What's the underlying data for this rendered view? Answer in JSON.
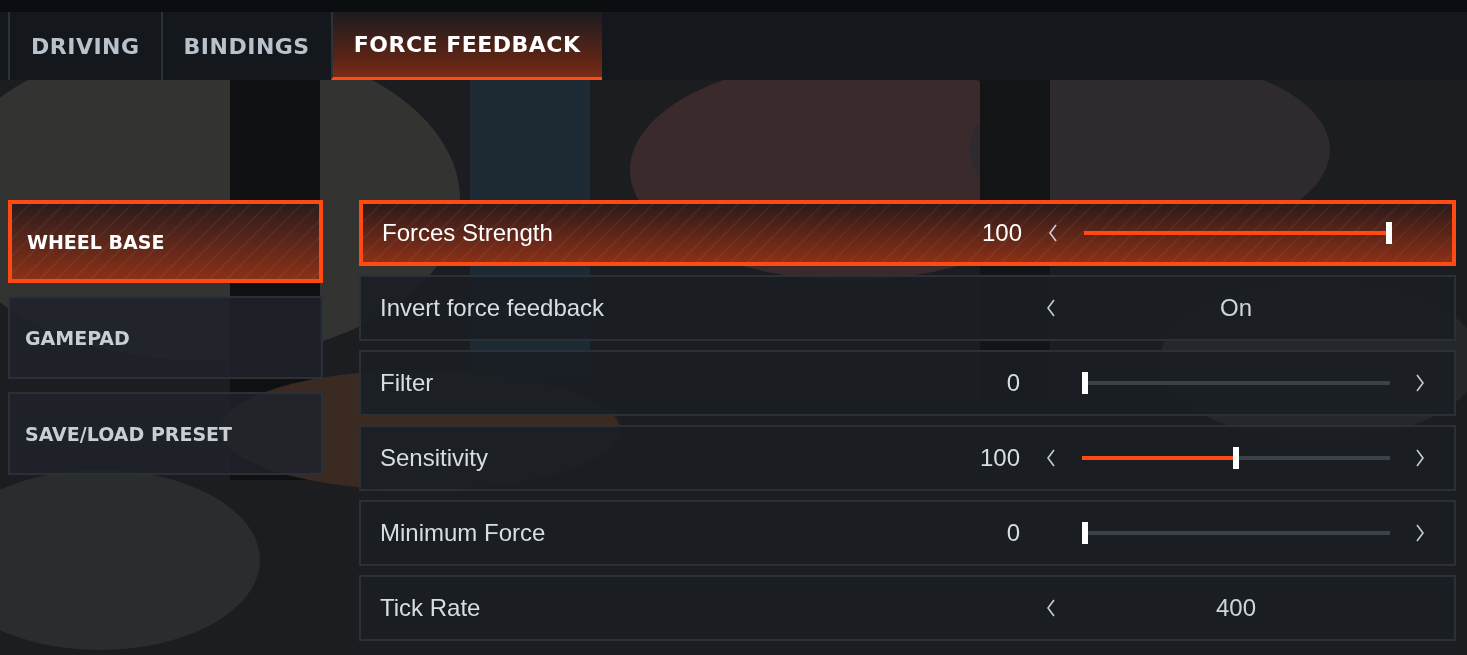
{
  "tabs": [
    {
      "label": "DRIVING",
      "selected": false
    },
    {
      "label": "BINDINGS",
      "selected": false
    },
    {
      "label": "FORCE FEEDBACK",
      "selected": true
    }
  ],
  "sidebar": {
    "items": [
      {
        "label": "WHEEL BASE",
        "selected": true
      },
      {
        "label": "GAMEPAD",
        "selected": false
      },
      {
        "label": "SAVE/LOAD PRESET",
        "selected": false
      }
    ]
  },
  "settings": [
    {
      "kind": "slider",
      "label": "Forces Strength",
      "value": "100",
      "level": 1,
      "selected": true,
      "can_decrease": true,
      "can_increase": false
    },
    {
      "kind": "option",
      "label": "Invert force feedback",
      "value": "On",
      "selected": false,
      "can_decrease": true,
      "can_increase": false
    },
    {
      "kind": "slider",
      "label": "Filter",
      "value": "0",
      "level": 0,
      "selected": false,
      "can_decrease": false,
      "can_increase": true
    },
    {
      "kind": "slider",
      "label": "Sensitivity",
      "value": "100",
      "level": 0.5,
      "selected": false,
      "can_decrease": true,
      "can_increase": true
    },
    {
      "kind": "slider",
      "label": "Minimum Force",
      "value": "0",
      "level": 0,
      "selected": false,
      "can_decrease": false,
      "can_increase": true
    },
    {
      "kind": "option",
      "label": "Tick Rate",
      "value": "400",
      "selected": false,
      "can_decrease": true,
      "can_increase": false
    }
  ]
}
